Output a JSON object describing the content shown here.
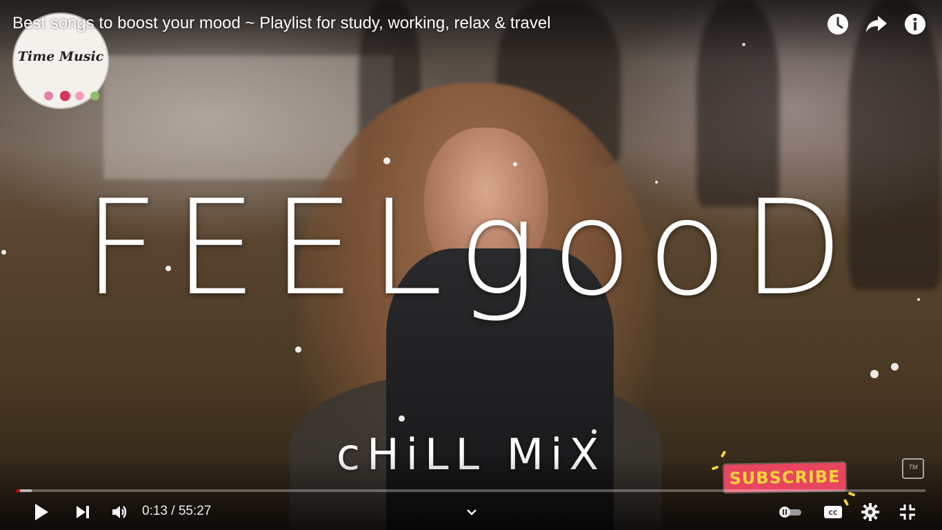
{
  "player": {
    "title": "Best songs to boost your mood ~ Playlist for study, working, relax & travel",
    "current_time": "0:13",
    "separator": "/",
    "duration": "55:27",
    "played_fraction": 0.004,
    "buffered_fraction": 0.017
  },
  "channel": {
    "logo_text": "Time Music"
  },
  "video_overlay": {
    "main_text": "FEELgooD",
    "sub_text": "cHiLL MiX",
    "subscribe_label": "SUBSCRIBE"
  },
  "icons": {
    "top": [
      "watch-later-icon",
      "share-icon",
      "info-icon"
    ],
    "bottom_left": [
      "play-icon",
      "next-icon",
      "volume-icon"
    ],
    "bottom_right": [
      "autoplay-toggle",
      "subtitles-icon",
      "settings-icon",
      "exit-fullscreen-icon"
    ]
  },
  "colors": {
    "progress_played": "#ff0000",
    "subscribe_bg": "#e8455f",
    "subscribe_text": "#f7d33a"
  }
}
